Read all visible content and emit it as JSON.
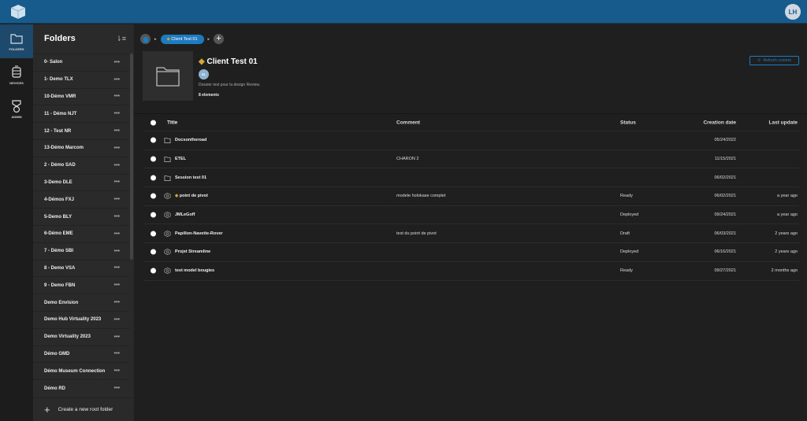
{
  "topbar": {
    "user_initials": "LH"
  },
  "rail": [
    {
      "label": "FOLDERS",
      "icon": "folder-icon",
      "active": true
    },
    {
      "label": "DEVICES",
      "icon": "devices-icon"
    },
    {
      "label": "ADMIN",
      "icon": "admin-badge-icon"
    }
  ],
  "sidebar": {
    "title": "Folders",
    "create_label": "Create a new root folder",
    "items": [
      "0- Salon",
      "1- Demo TLX",
      "10-Démo VMR",
      "11 - Démo NJT",
      "12 - Test NR",
      "13-Démo Marcom",
      "2 - Démo SAD",
      "3-Demo DLE",
      "4-Démos FXJ",
      "5-Demo BLY",
      "6-Démo EME",
      "7 - Démo SBI",
      "8 - Demo VSA",
      "9 - Demo FBN",
      "Demo Envision",
      "Demo Hub Virtuality 2023",
      "Demo Virtuality 2023",
      "Démo GMD",
      "Démo Museum Connection",
      "Démo RD"
    ]
  },
  "breadcrumb": {
    "current": "Client Test 01"
  },
  "folder": {
    "title": "Client Test 01",
    "owner_initials": "RL",
    "description": "Dossier test pour la design Review.",
    "count": "8 elements",
    "refresh_label": "Refresh content"
  },
  "table": {
    "headers": {
      "title": "Title",
      "comment": "Comment",
      "status": "Status",
      "created": "Creation date",
      "updated": "Last update"
    },
    "rows": [
      {
        "type": "folder",
        "title": "Docsontheroad",
        "comment": "",
        "status": "",
        "created": "05/24/2022",
        "updated": ""
      },
      {
        "type": "folder",
        "title": "ETEL",
        "comment": "CHARON 2",
        "status": "",
        "created": "11/15/2021",
        "updated": ""
      },
      {
        "type": "folder",
        "title": "Session test 01",
        "comment": "",
        "status": "",
        "created": "06/02/2021",
        "updated": ""
      },
      {
        "type": "model",
        "title": "point de pivot",
        "comment": "modele holokase complet",
        "status": "Ready",
        "created": "06/02/2021",
        "updated": "a year ago"
      },
      {
        "type": "model",
        "title": "JMLeGoff",
        "comment": "",
        "status": "Deployed",
        "created": "09/24/2021",
        "updated": "a year ago"
      },
      {
        "type": "model",
        "title": "Papillon-Navette-Rover",
        "comment": "test du point de pivot",
        "status": "Draft",
        "created": "06/03/2021",
        "updated": "2 years ago"
      },
      {
        "type": "model",
        "title": "Projet Streamline",
        "comment": "",
        "status": "Deployed",
        "created": "06/16/2021",
        "updated": "2 years ago"
      },
      {
        "type": "model",
        "title": "test model bougies",
        "comment": "",
        "status": "Ready",
        "created": "09/27/2021",
        "updated": "2 months ago"
      }
    ]
  },
  "colors": {
    "topbar": "#175b8c",
    "accent": "#1e7bc0",
    "background": "#1f1f1f",
    "sidebar": "#2a2a2a"
  }
}
